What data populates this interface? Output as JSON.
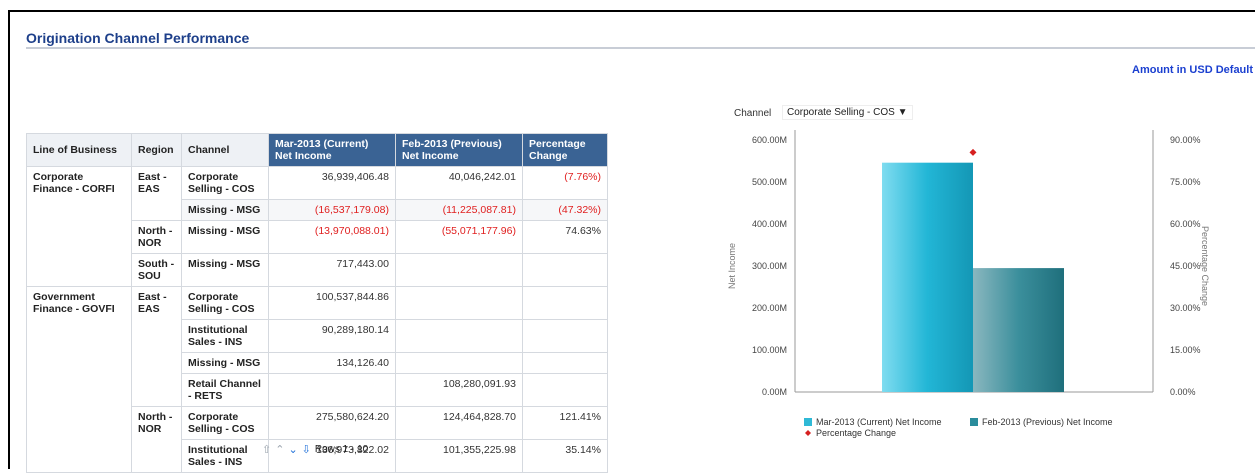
{
  "page": {
    "title": "Origination Channel Performance",
    "amount_note": "Amount in USD Default"
  },
  "table": {
    "headers": [
      "Line of Business",
      "Region",
      "Channel",
      "Mar-2013 (Current)",
      "Net Income",
      "Feb-2013 (Previous)",
      "Net Income",
      "Percentage",
      "Change"
    ],
    "rows": [
      {
        "lob": "Corporate Finance - CORFI",
        "region": "East - EAS",
        "channel": "Corporate Selling - COS",
        "cur": "36,939,406.48",
        "prev": "40,046,242.01",
        "pct": "(7.76%)"
      },
      {
        "lob": "",
        "region": "",
        "channel": "Missing - MSG",
        "cur": "(16,537,179.08)",
        "prev": "(11,225,087.81)",
        "pct": "(47.32%)"
      },
      {
        "lob": "",
        "region": "North - NOR",
        "channel": "Missing - MSG",
        "cur": "(13,970,088.01)",
        "prev": "(55,071,177.96)",
        "pct": "74.63%"
      },
      {
        "lob": "",
        "region": "South - SOU",
        "channel": "Missing - MSG",
        "cur": "717,443.00",
        "prev": "",
        "pct": ""
      },
      {
        "lob": "Government Finance - GOVFI",
        "region": "East - EAS",
        "channel": "Corporate Selling - COS",
        "cur": "100,537,844.86",
        "prev": "",
        "pct": ""
      },
      {
        "lob": "",
        "region": "",
        "channel": "Institutional Sales - INS",
        "cur": "90,289,180.14",
        "prev": "",
        "pct": ""
      },
      {
        "lob": "",
        "region": "",
        "channel": "Missing - MSG",
        "cur": "134,126.40",
        "prev": "",
        "pct": ""
      },
      {
        "lob": "",
        "region": "",
        "channel": "Retail Channel - RETS",
        "cur": "",
        "prev": "108,280,091.93",
        "pct": ""
      },
      {
        "lob": "",
        "region": "North - NOR",
        "channel": "Corporate Selling - COS",
        "cur": "275,580,624.20",
        "prev": "124,464,828.70",
        "pct": "121.41%"
      },
      {
        "lob": "",
        "region": "",
        "channel": "Institutional Sales - INS",
        "cur": "136,973,822.02",
        "prev": "101,355,225.98",
        "pct": "35.14%"
      }
    ],
    "pager_label": "Rows 1 - 10"
  },
  "chart_controls": {
    "label": "Channel",
    "selected": "Corporate Selling - COS"
  },
  "chart_data": {
    "type": "bar",
    "categories": [
      "Corporate Selling - COS"
    ],
    "series": [
      {
        "name": "Mar-2013 (Current) Net Income",
        "values": [
          546
        ],
        "color": "#2fb9d6",
        "axis": "left"
      },
      {
        "name": "Feb-2013 (Previous) Net Income",
        "values": [
          295
        ],
        "color": "#2a8c9c",
        "axis": "left"
      },
      {
        "name": "Percentage Change",
        "values": [
          0.8559
        ],
        "color": "#d62020",
        "axis": "right",
        "marker": "diamond"
      }
    ],
    "ylabel": "Net Income",
    "y2label": "Percentage Change",
    "ylim": [
      0,
      600
    ],
    "y2lim": [
      0,
      0.9
    ],
    "yticks": [
      "0.00M",
      "100.00M",
      "200.00M",
      "300.00M",
      "400.00M",
      "500.00M",
      "600.00M"
    ],
    "y2ticks": [
      "0.00%",
      "15.00%",
      "30.00%",
      "45.00%",
      "60.00%",
      "75.00%",
      "90.00%"
    ],
    "legend": "bottom"
  }
}
